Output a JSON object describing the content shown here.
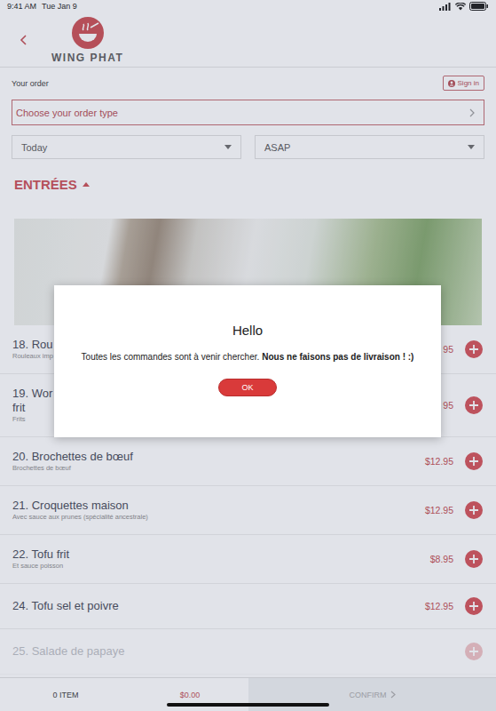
{
  "status_bar": {
    "time": "9:41 AM",
    "date": "Tue Jan 9"
  },
  "brand": {
    "name": "WING PHAT"
  },
  "order": {
    "label": "Your order",
    "sign_in": "Sign in",
    "order_type": "Choose your order type",
    "day": "Today",
    "time": "ASAP"
  },
  "section": {
    "title": "ENTRÉES",
    "expanded": true
  },
  "items": [
    {
      "name_lines": [
        "18. Rou"
      ],
      "description": "Rouleaux imp",
      "price": "95",
      "faded": false
    },
    {
      "name_lines": [
        "19. Wor",
        "frit"
      ],
      "description": "Frits",
      "price": "95",
      "faded": false
    },
    {
      "name_lines": [
        "20. Brochettes de bœuf"
      ],
      "description": "Brochettes de bœuf",
      "price": "$12.95",
      "faded": false
    },
    {
      "name_lines": [
        "21. Croquettes maison"
      ],
      "description": "Avec sauce aux prunes (spécialité ancestrale)",
      "price": "$12.95",
      "faded": false
    },
    {
      "name_lines": [
        "22. Tofu frit"
      ],
      "description": "Et sauce poisson",
      "price": "$8.95",
      "faded": false
    },
    {
      "name_lines": [
        "24. Tofu sel et poivre"
      ],
      "price": "$12.95",
      "faded": false
    },
    {
      "name_lines": [
        "25. Salade de papaye"
      ],
      "price": "",
      "faded": true
    }
  ],
  "cart": {
    "count": "0 ITEM",
    "total": "$0.00",
    "confirm": "CONFIRM",
    "confirm_disabled": true
  },
  "dialog": {
    "title": "Hello",
    "message": "Toutes les commandes sont à venir chercher.",
    "message_bold": "Nous ne faisons pas de livraison ! :)",
    "button": "OK"
  }
}
